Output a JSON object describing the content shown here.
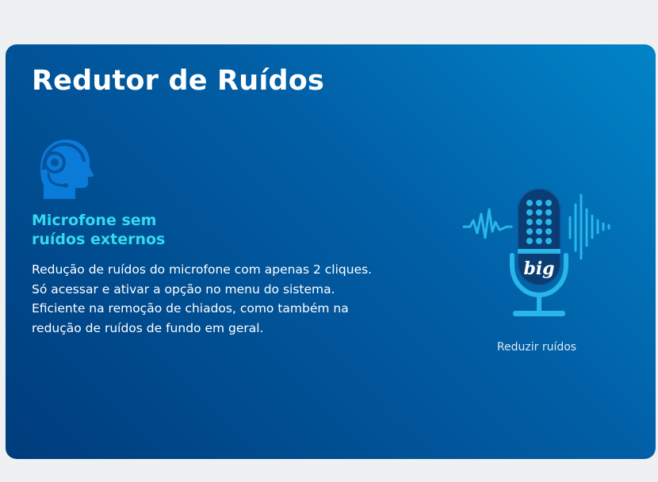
{
  "title": "Redutor de Ruídos",
  "feature": {
    "icon": "head-headphones-icon",
    "subtitle_line1": "Microfone sem",
    "subtitle_line2": "ruídos externos",
    "description_lines": [
      "Redução de ruídos do microfone com apenas 2 cliques.",
      "Só acessar e ativar a opção no menu do sistema.",
      "Eficiente na remoção de chiados, como também na",
      "redução de ruídos de fundo em geral."
    ]
  },
  "illustration": {
    "icon": "microphone-soundwave-icon",
    "badge_text": "big",
    "caption": "Reduzir ruídos"
  },
  "colors": {
    "page_background": "#eff0f2",
    "card_gradient_start": "#0184c8",
    "card_gradient_end": "#003c7c",
    "accent_cyan": "#35d9ef",
    "icon_blue": "#0a7bd9"
  }
}
